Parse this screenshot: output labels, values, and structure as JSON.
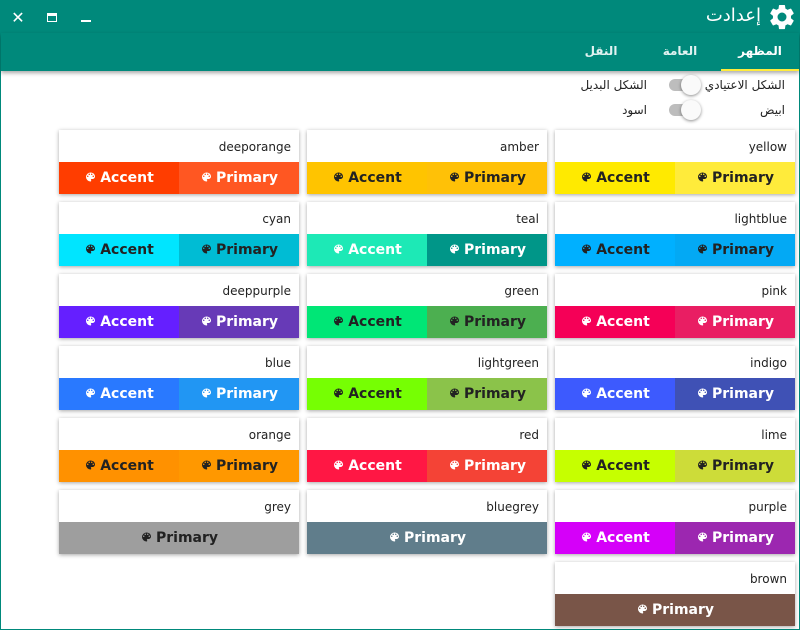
{
  "window": {
    "title": "إعدادت"
  },
  "tabs": [
    "المظهر",
    "العامة",
    "النقل"
  ],
  "options": {
    "theme_default": "الشكل الاعتيادي",
    "theme_alt": "الشكل البديل",
    "light": "ابيض",
    "dark": "اسود"
  },
  "labels": {
    "accent": "Accent",
    "primary": "Primary"
  },
  "swatches": [
    {
      "name": "yellow",
      "accent": "#ffea00",
      "primary": "#ffeb3b",
      "dark_text": true
    },
    {
      "name": "amber",
      "accent": "#ffc400",
      "primary": "#ffc107",
      "dark_text": true
    },
    {
      "name": "deeporange",
      "accent": "#ff3d00",
      "primary": "#ff5722",
      "dark_text": false
    },
    {
      "name": "lightblue",
      "accent": "#00b0ff",
      "primary": "#03a9f4",
      "dark_text": true
    },
    {
      "name": "teal",
      "accent": "#1de9b6",
      "primary": "#009688",
      "dark_text": false
    },
    {
      "name": "cyan",
      "accent": "#00e5ff",
      "primary": "#00bcd4",
      "dark_text": true
    },
    {
      "name": "pink",
      "accent": "#f50057",
      "primary": "#e91e63",
      "dark_text": false
    },
    {
      "name": "green",
      "accent": "#00e676",
      "primary": "#4caf50",
      "dark_text": true
    },
    {
      "name": "deeppurple",
      "accent": "#651fff",
      "primary": "#673ab7",
      "dark_text": false
    },
    {
      "name": "indigo",
      "accent": "#3d5afe",
      "primary": "#3f51b5",
      "dark_text": false
    },
    {
      "name": "lightgreen",
      "accent": "#76ff03",
      "primary": "#8bc34a",
      "dark_text": true
    },
    {
      "name": "blue",
      "accent": "#2979ff",
      "primary": "#2196f3",
      "dark_text": false
    },
    {
      "name": "lime",
      "accent": "#c6ff00",
      "primary": "#cddc39",
      "dark_text": true
    },
    {
      "name": "red",
      "accent": "#ff1744",
      "primary": "#f44336",
      "dark_text": false
    },
    {
      "name": "orange",
      "accent": "#ff9100",
      "primary": "#ff9800",
      "dark_text": true
    },
    {
      "name": "purple",
      "accent": "#d500f9",
      "primary": "#9c27b0",
      "dark_text": false
    },
    {
      "name": "bluegrey",
      "accent": null,
      "primary": "#607d8b",
      "dark_text": false
    },
    {
      "name": "grey",
      "accent": null,
      "primary": "#9e9e9e",
      "dark_text": true
    },
    {
      "name": "brown",
      "accent": null,
      "primary": "#795548",
      "dark_text": false
    }
  ],
  "colors": {
    "brand": "#00897b",
    "tab_indicator": "#ffeb3b"
  }
}
